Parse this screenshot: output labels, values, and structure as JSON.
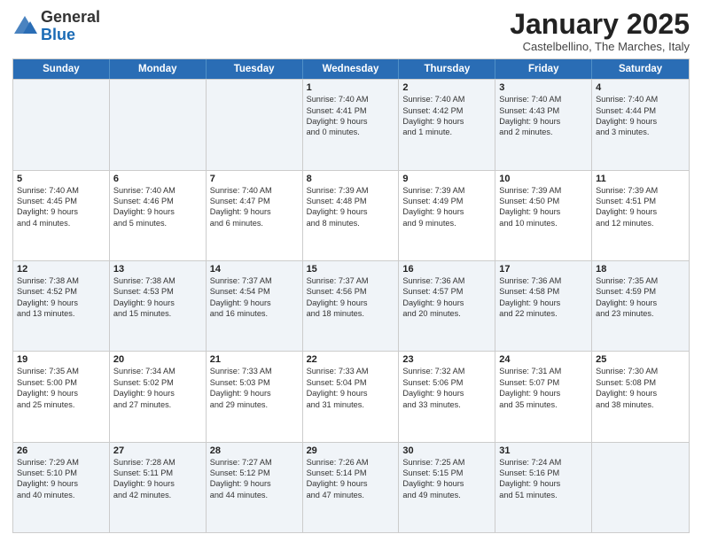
{
  "logo": {
    "general": "General",
    "blue": "Blue"
  },
  "header": {
    "month": "January 2025",
    "location": "Castelbellino, The Marches, Italy"
  },
  "days": [
    "Sunday",
    "Monday",
    "Tuesday",
    "Wednesday",
    "Thursday",
    "Friday",
    "Saturday"
  ],
  "weeks": [
    [
      {
        "day": "",
        "lines": []
      },
      {
        "day": "",
        "lines": []
      },
      {
        "day": "",
        "lines": []
      },
      {
        "day": "1",
        "lines": [
          "Sunrise: 7:40 AM",
          "Sunset: 4:41 PM",
          "Daylight: 9 hours",
          "and 0 minutes."
        ]
      },
      {
        "day": "2",
        "lines": [
          "Sunrise: 7:40 AM",
          "Sunset: 4:42 PM",
          "Daylight: 9 hours",
          "and 1 minute."
        ]
      },
      {
        "day": "3",
        "lines": [
          "Sunrise: 7:40 AM",
          "Sunset: 4:43 PM",
          "Daylight: 9 hours",
          "and 2 minutes."
        ]
      },
      {
        "day": "4",
        "lines": [
          "Sunrise: 7:40 AM",
          "Sunset: 4:44 PM",
          "Daylight: 9 hours",
          "and 3 minutes."
        ]
      }
    ],
    [
      {
        "day": "5",
        "lines": [
          "Sunrise: 7:40 AM",
          "Sunset: 4:45 PM",
          "Daylight: 9 hours",
          "and 4 minutes."
        ]
      },
      {
        "day": "6",
        "lines": [
          "Sunrise: 7:40 AM",
          "Sunset: 4:46 PM",
          "Daylight: 9 hours",
          "and 5 minutes."
        ]
      },
      {
        "day": "7",
        "lines": [
          "Sunrise: 7:40 AM",
          "Sunset: 4:47 PM",
          "Daylight: 9 hours",
          "and 6 minutes."
        ]
      },
      {
        "day": "8",
        "lines": [
          "Sunrise: 7:39 AM",
          "Sunset: 4:48 PM",
          "Daylight: 9 hours",
          "and 8 minutes."
        ]
      },
      {
        "day": "9",
        "lines": [
          "Sunrise: 7:39 AM",
          "Sunset: 4:49 PM",
          "Daylight: 9 hours",
          "and 9 minutes."
        ]
      },
      {
        "day": "10",
        "lines": [
          "Sunrise: 7:39 AM",
          "Sunset: 4:50 PM",
          "Daylight: 9 hours",
          "and 10 minutes."
        ]
      },
      {
        "day": "11",
        "lines": [
          "Sunrise: 7:39 AM",
          "Sunset: 4:51 PM",
          "Daylight: 9 hours",
          "and 12 minutes."
        ]
      }
    ],
    [
      {
        "day": "12",
        "lines": [
          "Sunrise: 7:38 AM",
          "Sunset: 4:52 PM",
          "Daylight: 9 hours",
          "and 13 minutes."
        ]
      },
      {
        "day": "13",
        "lines": [
          "Sunrise: 7:38 AM",
          "Sunset: 4:53 PM",
          "Daylight: 9 hours",
          "and 15 minutes."
        ]
      },
      {
        "day": "14",
        "lines": [
          "Sunrise: 7:37 AM",
          "Sunset: 4:54 PM",
          "Daylight: 9 hours",
          "and 16 minutes."
        ]
      },
      {
        "day": "15",
        "lines": [
          "Sunrise: 7:37 AM",
          "Sunset: 4:56 PM",
          "Daylight: 9 hours",
          "and 18 minutes."
        ]
      },
      {
        "day": "16",
        "lines": [
          "Sunrise: 7:36 AM",
          "Sunset: 4:57 PM",
          "Daylight: 9 hours",
          "and 20 minutes."
        ]
      },
      {
        "day": "17",
        "lines": [
          "Sunrise: 7:36 AM",
          "Sunset: 4:58 PM",
          "Daylight: 9 hours",
          "and 22 minutes."
        ]
      },
      {
        "day": "18",
        "lines": [
          "Sunrise: 7:35 AM",
          "Sunset: 4:59 PM",
          "Daylight: 9 hours",
          "and 23 minutes."
        ]
      }
    ],
    [
      {
        "day": "19",
        "lines": [
          "Sunrise: 7:35 AM",
          "Sunset: 5:00 PM",
          "Daylight: 9 hours",
          "and 25 minutes."
        ]
      },
      {
        "day": "20",
        "lines": [
          "Sunrise: 7:34 AM",
          "Sunset: 5:02 PM",
          "Daylight: 9 hours",
          "and 27 minutes."
        ]
      },
      {
        "day": "21",
        "lines": [
          "Sunrise: 7:33 AM",
          "Sunset: 5:03 PM",
          "Daylight: 9 hours",
          "and 29 minutes."
        ]
      },
      {
        "day": "22",
        "lines": [
          "Sunrise: 7:33 AM",
          "Sunset: 5:04 PM",
          "Daylight: 9 hours",
          "and 31 minutes."
        ]
      },
      {
        "day": "23",
        "lines": [
          "Sunrise: 7:32 AM",
          "Sunset: 5:06 PM",
          "Daylight: 9 hours",
          "and 33 minutes."
        ]
      },
      {
        "day": "24",
        "lines": [
          "Sunrise: 7:31 AM",
          "Sunset: 5:07 PM",
          "Daylight: 9 hours",
          "and 35 minutes."
        ]
      },
      {
        "day": "25",
        "lines": [
          "Sunrise: 7:30 AM",
          "Sunset: 5:08 PM",
          "Daylight: 9 hours",
          "and 38 minutes."
        ]
      }
    ],
    [
      {
        "day": "26",
        "lines": [
          "Sunrise: 7:29 AM",
          "Sunset: 5:10 PM",
          "Daylight: 9 hours",
          "and 40 minutes."
        ]
      },
      {
        "day": "27",
        "lines": [
          "Sunrise: 7:28 AM",
          "Sunset: 5:11 PM",
          "Daylight: 9 hours",
          "and 42 minutes."
        ]
      },
      {
        "day": "28",
        "lines": [
          "Sunrise: 7:27 AM",
          "Sunset: 5:12 PM",
          "Daylight: 9 hours",
          "and 44 minutes."
        ]
      },
      {
        "day": "29",
        "lines": [
          "Sunrise: 7:26 AM",
          "Sunset: 5:14 PM",
          "Daylight: 9 hours",
          "and 47 minutes."
        ]
      },
      {
        "day": "30",
        "lines": [
          "Sunrise: 7:25 AM",
          "Sunset: 5:15 PM",
          "Daylight: 9 hours",
          "and 49 minutes."
        ]
      },
      {
        "day": "31",
        "lines": [
          "Sunrise: 7:24 AM",
          "Sunset: 5:16 PM",
          "Daylight: 9 hours",
          "and 51 minutes."
        ]
      },
      {
        "day": "",
        "lines": []
      }
    ]
  ],
  "alt_weeks": [
    0,
    2,
    4
  ]
}
